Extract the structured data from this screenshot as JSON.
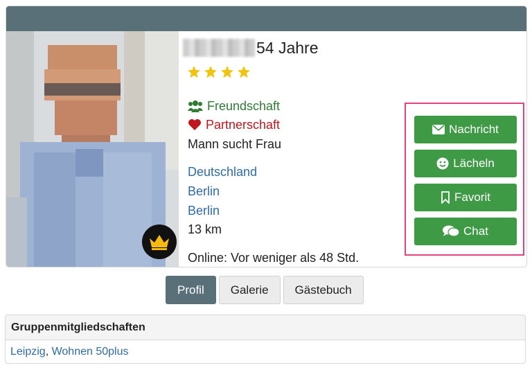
{
  "profile": {
    "age_text": "54 Jahre",
    "rating_stars": 4,
    "star_color": "#f1c40f",
    "interests": [
      {
        "label": "Freundschaft",
        "icon": "users-icon",
        "color": "#2e7d32"
      },
      {
        "label": "Partnerschaft",
        "icon": "heart-icon",
        "color": "#c0161d"
      }
    ],
    "seeking": "Mann sucht Frau",
    "country": "Deutschland",
    "state": "Berlin",
    "city": "Berlin",
    "distance": "13 km",
    "online_status": "Online: Vor weniger als 48 Std.",
    "premium_badge_icon": "crown-icon"
  },
  "actions": [
    {
      "label": "Nachricht",
      "icon": "envelope-icon"
    },
    {
      "label": "Lächeln",
      "icon": "smile-icon"
    },
    {
      "label": "Favorit",
      "icon": "bookmark-icon"
    },
    {
      "label": "Chat",
      "icon": "comments-icon"
    }
  ],
  "tabs": [
    {
      "label": "Profil",
      "active": true
    },
    {
      "label": "Galerie",
      "active": false
    },
    {
      "label": "Gästebuch",
      "active": false
    }
  ],
  "groups": {
    "title": "Gruppenmitgliedschaften",
    "items": [
      "Leipzig",
      "Wohnen 50plus"
    ],
    "separator": ", "
  },
  "colors": {
    "header": "#5a7079",
    "action_button": "#3f9a45",
    "highlight_border": "#e24080",
    "link": "#2f6ca5"
  }
}
